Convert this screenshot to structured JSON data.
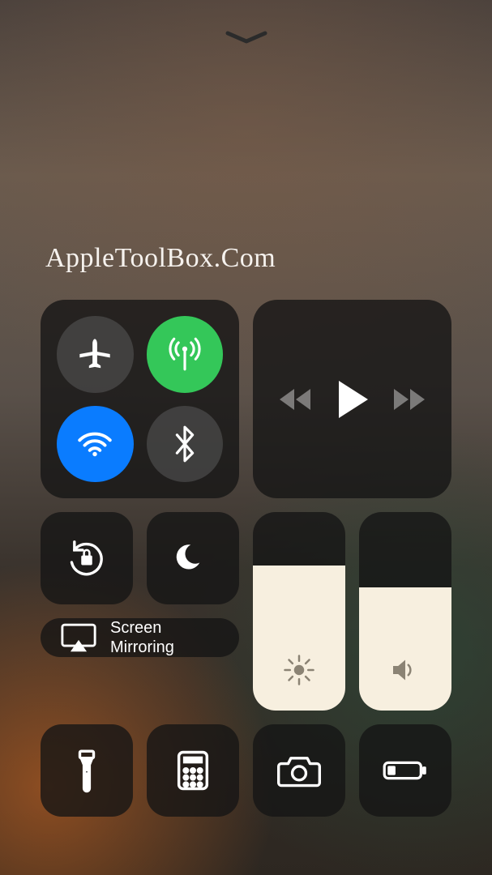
{
  "watermark": "AppleToolBox.Com",
  "screen_mirroring": {
    "label": "Screen\nMirroring"
  },
  "sliders": {
    "brightness": {
      "percent": 73
    },
    "volume": {
      "percent": 62
    }
  },
  "toggles": {
    "airplane": {
      "on": false
    },
    "cellular": {
      "on": true
    },
    "wifi": {
      "on": true
    },
    "bluetooth": {
      "on": false
    }
  },
  "icons": {
    "caret": "chevron-down",
    "airplane": "airplane",
    "cellular": "antenna",
    "wifi": "wifi",
    "bluetooth": "bluetooth",
    "orientation_lock": "rotation-lock",
    "dnd": "moon",
    "screen_mirror": "airplay",
    "brightness": "sun",
    "volume": "speaker",
    "flashlight": "flashlight",
    "calculator": "calculator",
    "camera": "camera",
    "low_power": "battery-low"
  }
}
